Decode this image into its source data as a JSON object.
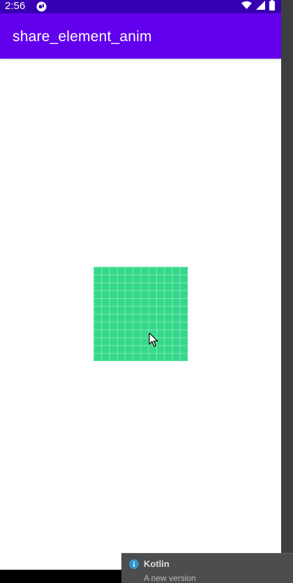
{
  "status_bar": {
    "time": "2:56",
    "icons": [
      "app-notification-icon",
      "wifi-icon",
      "signal-icon",
      "battery-icon"
    ],
    "color": "#3700b3"
  },
  "app_bar": {
    "title": "share_element_anim",
    "color": "#6200ee"
  },
  "content": {
    "shared_element": {
      "description_icon": "grid-tile-image",
      "color": "#35d98a"
    }
  },
  "notification": {
    "icon": "info-icon",
    "title": "Kotlin",
    "body": "A new version"
  }
}
